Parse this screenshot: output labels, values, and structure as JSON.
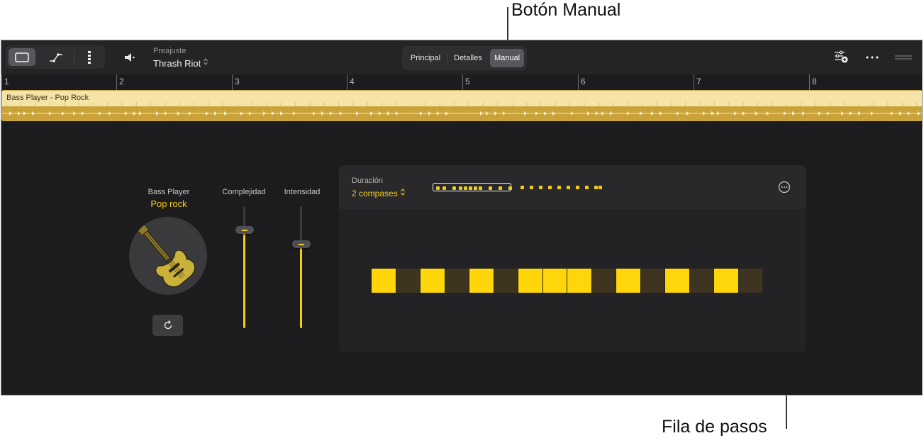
{
  "callouts": {
    "manual_button": "Botón Manual",
    "step_row": "Fila de pasos"
  },
  "toolbar": {
    "view_buttons": [
      "single-pane-icon",
      "automation-curve-icon",
      "lane-list-icon"
    ],
    "preset_caption": "Preajuste",
    "preset_value": "Thrash Riot",
    "tabs": [
      {
        "label": "Principal",
        "active": false
      },
      {
        "label": "Detalles",
        "active": false
      },
      {
        "label": "Manual",
        "active": true
      }
    ]
  },
  "ruler": {
    "bars": [
      "1",
      "2",
      "3",
      "4",
      "5",
      "6",
      "7",
      "8"
    ]
  },
  "region": {
    "title": "Bass Player - Pop Rock"
  },
  "player": {
    "name": "Bass Player",
    "style": "Pop rock",
    "complexity_label": "Complejidad",
    "complexity_value": 0.82,
    "intensity_label": "Intensidad",
    "intensity_value": 0.7
  },
  "beat": {
    "duration_label": "Duración",
    "duration_value": "2 compases",
    "steps": [
      1,
      0,
      1,
      0,
      1,
      0,
      1,
      1,
      1,
      0,
      1,
      0,
      1,
      0,
      1,
      0
    ]
  },
  "colors": {
    "accent": "#ffd60a",
    "background": "#1c1c1f",
    "region": "#f5e3a8",
    "region_wave": "#c9a33a",
    "step_off": "#3e3420"
  }
}
